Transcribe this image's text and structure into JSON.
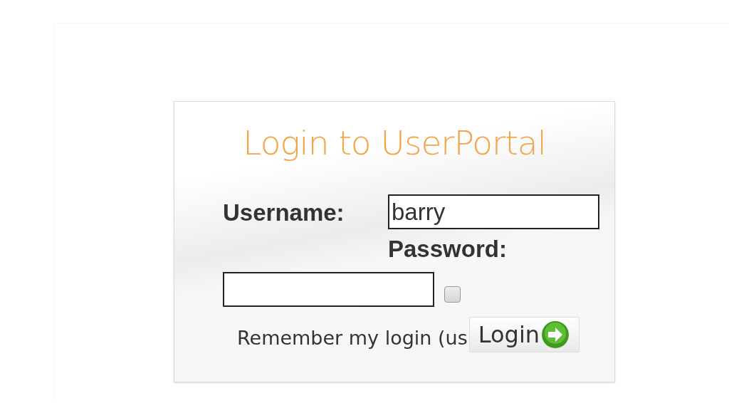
{
  "title": "Login to UserPortal",
  "username": {
    "label": "Username:",
    "value": "barry"
  },
  "password": {
    "label": "Password:"
  },
  "remember": {
    "label": "Remember my login (us",
    "checked": false
  },
  "login_button": {
    "label": "Login"
  }
}
